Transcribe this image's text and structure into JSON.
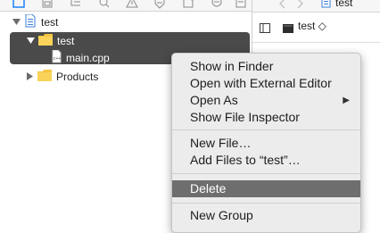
{
  "navigator": {
    "project_name": "test",
    "items": [
      {
        "label": "test"
      },
      {
        "label": "main.cpp"
      },
      {
        "label": "Products"
      }
    ]
  },
  "editor": {
    "tab_title": "test",
    "scheme_label": "test ◇"
  },
  "context_menu": {
    "groups": [
      [
        "Show in Finder",
        "Open with External Editor",
        "Open As",
        "Show File Inspector"
      ],
      [
        "New File…",
        "Add Files to “test”…"
      ],
      [
        "Delete"
      ],
      [
        "New Group"
      ]
    ],
    "highlighted": "Delete",
    "submenu_arrow": "▶"
  },
  "colors": {
    "selection": "#4a4a4a",
    "folder": "#f6c544",
    "highlight": "#6e6e6e",
    "accent": "#1a82fb"
  },
  "icons": [
    "file-icon",
    "folder-icon",
    "chevron-left-icon",
    "chevron-right-icon",
    "document-icon",
    "sidebar-toggle-icon",
    "scheme-icon"
  ]
}
